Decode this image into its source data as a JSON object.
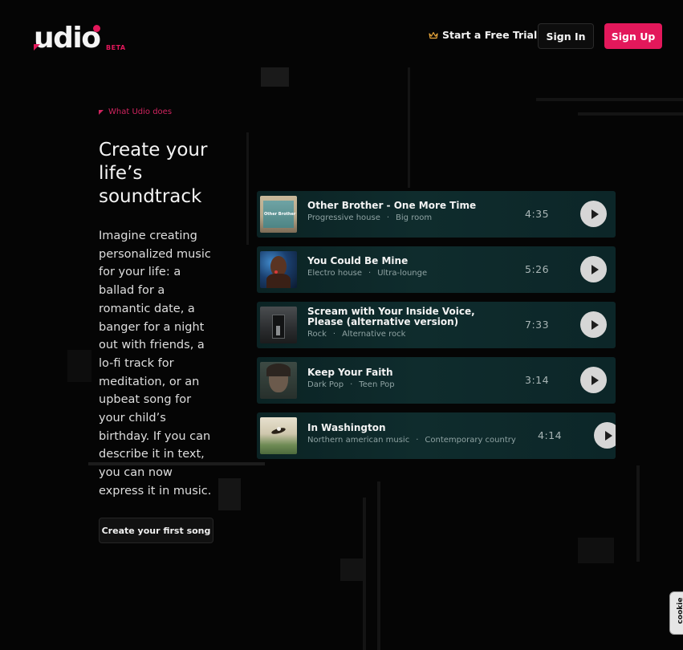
{
  "header": {
    "logo_text": "udio",
    "logo_badge": "BETA",
    "trial_label": "Start a Free Trial",
    "signin_label": "Sign In",
    "signup_label": "Sign Up"
  },
  "hero": {
    "eyebrow": "What Udio does",
    "headline": "Create your life’s soundtrack",
    "description": "Imagine creating personalized music for your life: a ballad for a romantic date, a banger for a night out with friends, a lo-fi track for meditation, or an upbeat song for your child’s birthday. If you can describe it in text, you can now express it in music.",
    "cta_label": "Create your first song"
  },
  "tracks": [
    {
      "title": "Other Brother - One More Time",
      "genre": "Progressive house",
      "subgenre": "Big room",
      "duration": "4:35",
      "thumb_text": "Other Brother"
    },
    {
      "title": "You Could Be Mine",
      "genre": "Electro house",
      "subgenre": "Ultra-lounge",
      "duration": "5:26"
    },
    {
      "title": "Scream with Your Inside Voice, Please (alternative version)",
      "genre": "Rock",
      "subgenre": "Alternative rock",
      "duration": "7:33"
    },
    {
      "title": "Keep Your Faith",
      "genre": "Dark Pop",
      "subgenre": "Teen Pop",
      "duration": "3:14"
    },
    {
      "title": "In Washington",
      "genre": "Northern american music",
      "subgenre": "Contemporary country",
      "duration": "4:14"
    }
  ],
  "cookie": {
    "label": "cookie"
  },
  "colors": {
    "accent": "#e3185b",
    "track_bg": "#0f2c2d",
    "background": "#050505"
  }
}
